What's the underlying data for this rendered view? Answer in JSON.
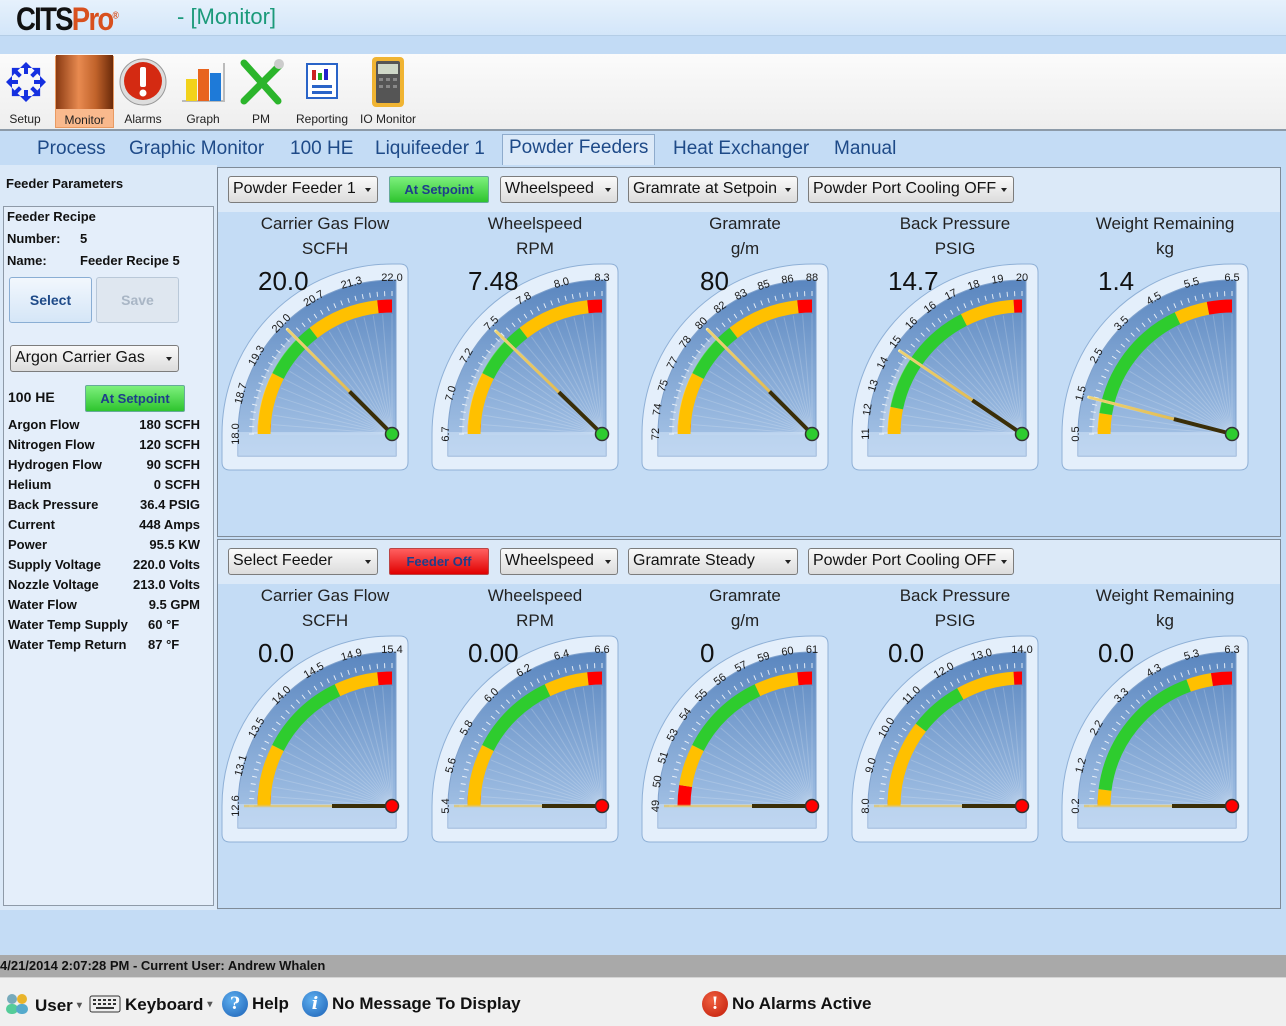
{
  "app": {
    "logo_main": "CITS",
    "logo_accent": "Pro",
    "logo_mark": "®",
    "window_title": "- [Monitor]"
  },
  "ribbon": [
    {
      "id": "setup",
      "label": "Setup",
      "icon": "setup-arrows-icon",
      "active": false
    },
    {
      "id": "monitor",
      "label": "Monitor",
      "icon": "monitor-photo-icon",
      "active": true
    },
    {
      "id": "alarms",
      "label": "Alarms",
      "icon": "alarm-exclamation-icon",
      "active": false
    },
    {
      "id": "graph",
      "label": "Graph",
      "icon": "bar-graph-icon",
      "active": false
    },
    {
      "id": "pm",
      "label": "PM",
      "icon": "wrench-screwdriver-icon",
      "active": false
    },
    {
      "id": "reporting",
      "label": "Reporting",
      "icon": "report-icon",
      "active": false
    },
    {
      "id": "io-monitor",
      "label": "IO Monitor",
      "icon": "multimeter-icon",
      "active": false
    }
  ],
  "tabs": [
    {
      "label": "Process",
      "active": false
    },
    {
      "label": "Graphic Monitor",
      "active": false
    },
    {
      "label": "100 HE",
      "active": false
    },
    {
      "label": "Liquifeeder 1",
      "active": false
    },
    {
      "label": "Powder Feeders",
      "active": true
    },
    {
      "label": "Heat Exchanger",
      "active": false
    },
    {
      "label": "Manual",
      "active": false
    }
  ],
  "left_panel": {
    "header": "Feeder Parameters",
    "recipe_title": "Feeder Recipe",
    "number_label": "Number:",
    "number_value": "5",
    "name_label": "Name:",
    "name_value": "Feeder Recipe 5",
    "select_label": "Select",
    "save_label": "Save",
    "carrier_gas": "Argon Carrier Gas",
    "gun_label": "100 HE",
    "gun_status": "At Setpoint",
    "params": [
      {
        "label": "Argon Flow",
        "value": "180 SCFH"
      },
      {
        "label": "Nitrogen Flow",
        "value": "120 SCFH"
      },
      {
        "label": "Hydrogen Flow",
        "value": "90 SCFH"
      },
      {
        "label": "Helium",
        "value": "0 SCFH"
      },
      {
        "label": "Back Pressure",
        "value": "36.4 PSIG"
      },
      {
        "label": "Current",
        "value": "448 Amps"
      },
      {
        "label": "Power",
        "value": "95.5 KW"
      },
      {
        "label": "Supply Voltage",
        "value": "220.0 Volts"
      },
      {
        "label": "Nozzle Voltage",
        "value": "213.0 Volts"
      },
      {
        "label": "Water Flow",
        "value": "9.5 GPM"
      },
      {
        "label": "Water Temp Supply",
        "value": "60 °F"
      },
      {
        "label": "Water Temp Return",
        "value": "87 °F"
      }
    ]
  },
  "feeders": [
    {
      "feeder_select": "Powder Feeder 1",
      "status": "At Setpoint",
      "status_color": "#2ec42e",
      "mode_select": "Wheelspeed",
      "gramrate_select": "Gramrate at Setpoin",
      "cooling_select": "Powder Port Cooling OFF",
      "gauges": [
        {
          "title": "Carrier Gas Flow",
          "unit": "SCFH",
          "value_text": "20.0",
          "value": 20.0,
          "min": 18.0,
          "max": 22.0,
          "ticks": [
            "18.0",
            "18.7",
            "19.3",
            "20.0",
            "20.7",
            "21.3",
            "22.0"
          ],
          "bands": [
            [
              0,
              0.06,
              "#ff0000"
            ],
            [
              0,
              0.3,
              "#ffc000"
            ],
            [
              0.3,
              0.58,
              "#2ecc2e"
            ],
            [
              0.58,
              0.93,
              "#ffc000"
            ],
            [
              0.93,
              1,
              "#ff0000"
            ]
          ],
          "pivot": "#2ecc2e",
          "needle_frac": 0.5
        },
        {
          "title": "Wheelspeed",
          "unit": "RPM",
          "value_text": "7.48",
          "value": 7.48,
          "min": 6.7,
          "max": 8.3,
          "ticks": [
            "6.7",
            "7.0",
            "7.2",
            "7.5",
            "7.8",
            "8.0",
            "8.3"
          ],
          "bands": [
            [
              0,
              0.06,
              "#ff0000"
            ],
            [
              0,
              0.3,
              "#ffc000"
            ],
            [
              0.3,
              0.58,
              "#2ecc2e"
            ],
            [
              0.58,
              0.93,
              "#ffc000"
            ],
            [
              0.93,
              1,
              "#ff0000"
            ]
          ],
          "pivot": "#2ecc2e",
          "needle_frac": 0.49
        },
        {
          "title": "Gramrate",
          "unit": "g/m",
          "value_text": "80",
          "value": 80,
          "min": 72,
          "max": 88,
          "ticks": [
            "72",
            "74",
            "75",
            "77",
            "78",
            "80",
            "82",
            "83",
            "85",
            "86",
            "88"
          ],
          "bands": [
            [
              0,
              0.06,
              "#ff0000"
            ],
            [
              0,
              0.3,
              "#ffc000"
            ],
            [
              0.3,
              0.58,
              "#2ecc2e"
            ],
            [
              0.58,
              0.93,
              "#ffc000"
            ],
            [
              0.93,
              1,
              "#ff0000"
            ]
          ],
          "pivot": "#2ecc2e",
          "needle_frac": 0.5
        },
        {
          "title": "Back Pressure",
          "unit": "PSIG",
          "value_text": "14.7",
          "value": 14.7,
          "min": 11,
          "max": 20,
          "ticks": [
            "11",
            "12",
            "13",
            "14",
            "15",
            "16",
            "16",
            "17",
            "18",
            "19",
            "20"
          ],
          "bands": [
            [
              0,
              0.03,
              "#ff0000"
            ],
            [
              0,
              0.13,
              "#ffc000"
            ],
            [
              0.13,
              0.7,
              "#2ecc2e"
            ],
            [
              0.7,
              0.96,
              "#ffc000"
            ],
            [
              0.96,
              1,
              "#ff0000"
            ]
          ],
          "pivot": "#2ecc2e",
          "needle_frac": 0.38
        },
        {
          "title": "Weight Remaining",
          "unit": "kg",
          "value_text": "1.4",
          "value": 1.4,
          "min": 0.5,
          "max": 6.5,
          "ticks": [
            "0.5",
            "1.5",
            "2.5",
            "3.5",
            "4.5",
            "5.5",
            "6.5"
          ],
          "bands": [
            [
              0,
              0.03,
              "#ff0000"
            ],
            [
              0,
              0.1,
              "#ffc000"
            ],
            [
              0.1,
              0.72,
              "#2ecc2e"
            ],
            [
              0.72,
              0.88,
              "#ffc000"
            ],
            [
              0.88,
              1,
              "#ff0000"
            ]
          ],
          "pivot": "#2ecc2e",
          "needle_frac": 0.16
        }
      ]
    },
    {
      "feeder_select": "Select Feeder",
      "status": "Feeder Off",
      "status_color": "#e00000",
      "mode_select": "Wheelspeed",
      "gramrate_select": "Gramrate Steady",
      "cooling_select": "Powder Port Cooling OFF",
      "gauges": [
        {
          "title": "Carrier Gas Flow",
          "unit": "SCFH",
          "value_text": "0.0",
          "value": 0.0,
          "min": 12.6,
          "max": 15.4,
          "ticks": [
            "12.6",
            "13.1",
            "13.5",
            "14.0",
            "14.5",
            "14.9",
            "15.4"
          ],
          "bands": [
            [
              0,
              0.06,
              "#ff0000"
            ],
            [
              0,
              0.3,
              "#ffc000"
            ],
            [
              0.3,
              0.72,
              "#2ecc2e"
            ],
            [
              0.72,
              0.93,
              "#ffc000"
            ],
            [
              0.93,
              1,
              "#ff0000"
            ]
          ],
          "pivot": "#ff0000",
          "needle_frac": 0
        },
        {
          "title": "Wheelspeed",
          "unit": "RPM",
          "value_text": "0.00",
          "value": 0.0,
          "min": 5.4,
          "max": 6.6,
          "ticks": [
            "5.4",
            "5.6",
            "5.8",
            "6.0",
            "6.2",
            "6.4",
            "6.6"
          ],
          "bands": [
            [
              0,
              0.06,
              "#ff0000"
            ],
            [
              0,
              0.3,
              "#ffc000"
            ],
            [
              0.3,
              0.72,
              "#2ecc2e"
            ],
            [
              0.72,
              0.93,
              "#ffc000"
            ],
            [
              0.93,
              1,
              "#ff0000"
            ]
          ],
          "pivot": "#ff0000",
          "needle_frac": 0
        },
        {
          "title": "Gramrate",
          "unit": "g/m",
          "value_text": "0",
          "value": 0,
          "min": 49,
          "max": 61,
          "ticks": [
            "49",
            "50",
            "51",
            "53",
            "54",
            "55",
            "56",
            "57",
            "59",
            "60",
            "61"
          ],
          "bands": [
            [
              0,
              0.1,
              "#ff0000"
            ],
            [
              0.1,
              0.3,
              "#ffc000"
            ],
            [
              0.3,
              0.72,
              "#2ecc2e"
            ],
            [
              0.72,
              0.93,
              "#ffc000"
            ],
            [
              0.93,
              1,
              "#ff0000"
            ]
          ],
          "pivot": "#ff0000",
          "needle_frac": 0
        },
        {
          "title": "Back Pressure",
          "unit": "PSIG",
          "value_text": "0.0",
          "value": 0.0,
          "min": 8.0,
          "max": 14.0,
          "ticks": [
            "8.0",
            "9.0",
            "10.0",
            "11.0",
            "12.0",
            "13.0",
            "14.0"
          ],
          "bands": [
            [
              0,
              0.03,
              "#ff0000"
            ],
            [
              0,
              0.42,
              "#ffc000"
            ],
            [
              0.42,
              0.68,
              "#2ecc2e"
            ],
            [
              0.68,
              0.96,
              "#ffc000"
            ],
            [
              0.96,
              1,
              "#ff0000"
            ]
          ],
          "pivot": "#ff0000",
          "needle_frac": 0
        },
        {
          "title": "Weight Remaining",
          "unit": "kg",
          "value_text": "0.0",
          "value": 0.0,
          "min": 0.2,
          "max": 6.3,
          "ticks": [
            "0.2",
            "1.2",
            "2.2",
            "3.3",
            "4.3",
            "5.3",
            "6.3"
          ],
          "bands": [
            [
              0,
              0.03,
              "#ff0000"
            ],
            [
              0,
              0.08,
              "#ffc000"
            ],
            [
              0.08,
              0.78,
              "#2ecc2e"
            ],
            [
              0.78,
              0.9,
              "#ffc000"
            ],
            [
              0.9,
              1,
              "#ff0000"
            ]
          ],
          "pivot": "#ff0000",
          "needle_frac": 0
        }
      ]
    }
  ],
  "status": {
    "text": "4/21/2014 2:07:28 PM - Current User:  Andrew Whalen"
  },
  "bottom": {
    "user_label": "User",
    "keyboard_label": "Keyboard",
    "help_label": "Help",
    "message": "No Message To Display",
    "alarms": "No Alarms Active"
  }
}
